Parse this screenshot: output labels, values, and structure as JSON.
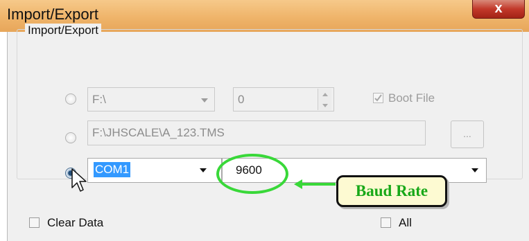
{
  "window": {
    "title": "Import/Export",
    "close_label": "x"
  },
  "group": {
    "label": "Import/Export"
  },
  "row1": {
    "drive_value": "F:\\",
    "number_value": "0",
    "boot_file_label": "Boot File"
  },
  "row2": {
    "path_value": "F:\\JHSCALE\\A_123.TMS",
    "browse_label": "..."
  },
  "row3": {
    "port_value": "COM1",
    "baud_value": "9600"
  },
  "annotation": {
    "label": "Baud Rate"
  },
  "bottom": {
    "clear_data_label": "Clear Data",
    "all_label": "All"
  },
  "colors": {
    "highlight": "#39d839",
    "callout_text": "#18a818",
    "selection": "#3399ff"
  }
}
